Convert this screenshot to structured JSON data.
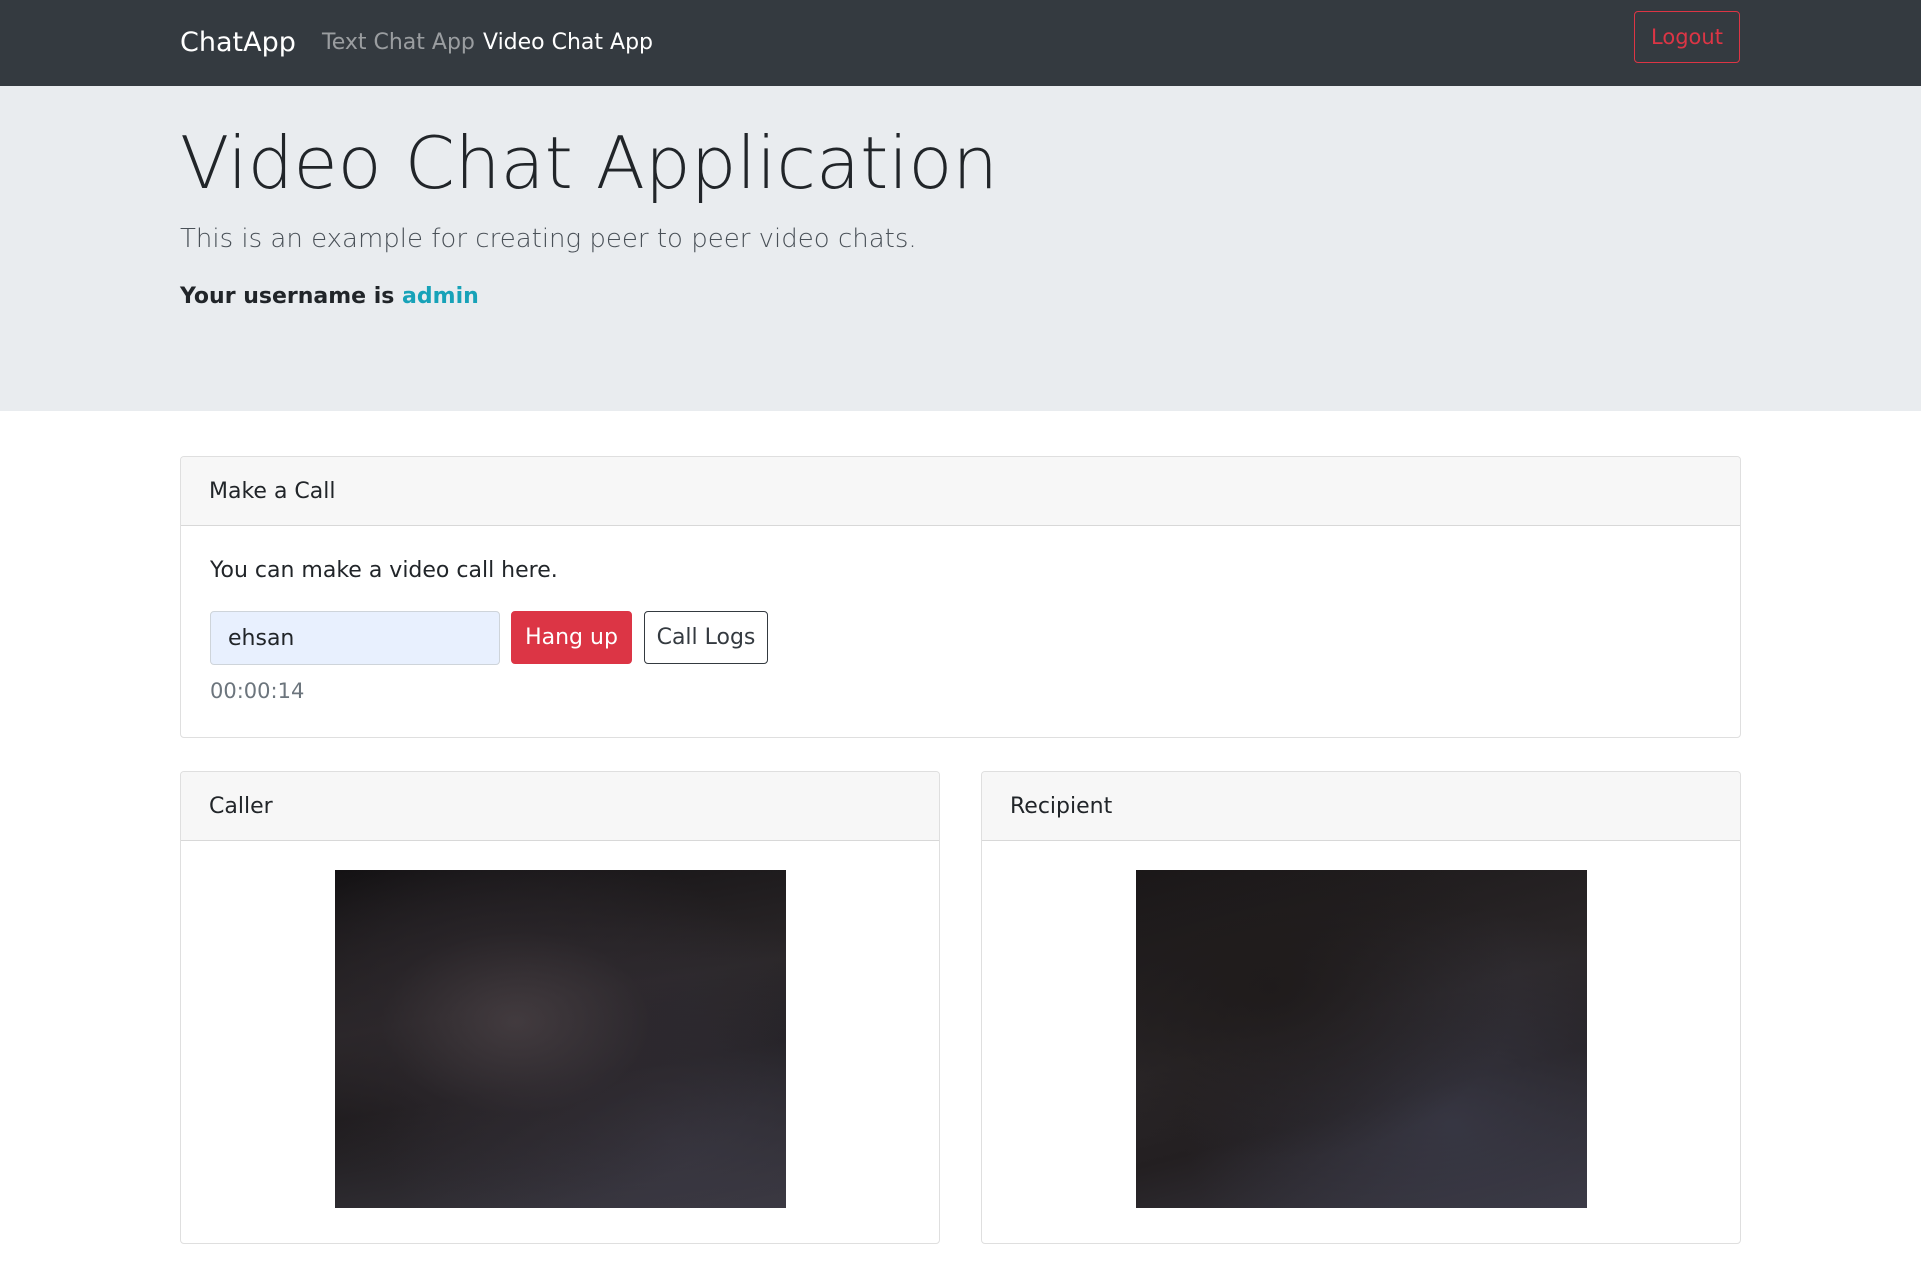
{
  "navbar": {
    "brand": "ChatApp",
    "links": [
      {
        "label": "Text Chat App",
        "active": false
      },
      {
        "label": "Video Chat App",
        "active": true
      }
    ],
    "logout_label": "Logout"
  },
  "jumbotron": {
    "title": "Video Chat Application",
    "lead": "This is an example for creating peer to peer video chats.",
    "username_prefix": "Your username is",
    "username": "admin"
  },
  "call_card": {
    "header": "Make a Call",
    "description": "You can make a video call here.",
    "input_value": "ehsan",
    "hangup_label": "Hang up",
    "logs_label": "Call Logs",
    "timer": "00:00:14"
  },
  "caller_card": {
    "header": "Caller"
  },
  "recipient_card": {
    "header": "Recipient"
  },
  "colors": {
    "navbar_bg": "#343a40",
    "jumbotron_bg": "#e9ecef",
    "danger": "#dc3545",
    "info": "#17a2b8",
    "dark": "#343a40"
  }
}
